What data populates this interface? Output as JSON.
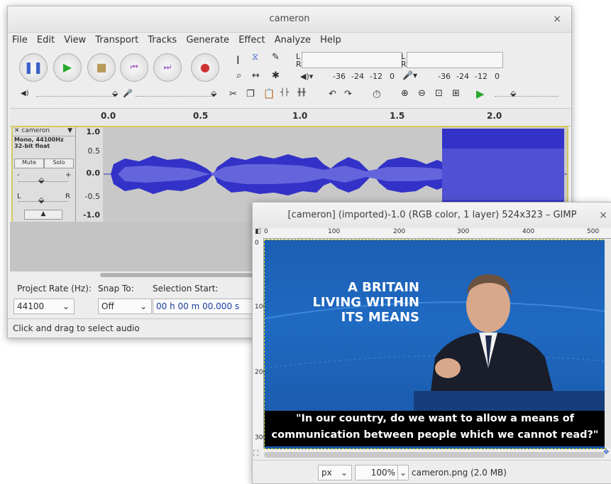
{
  "audacity": {
    "title": "cameron",
    "close": "×",
    "menu": [
      "File",
      "Edit",
      "View",
      "Transport",
      "Tracks",
      "Generate",
      "Effect",
      "Analyze",
      "Help"
    ],
    "meter": {
      "l": "L",
      "r": "R",
      "ticks": [
        "-36",
        "-24",
        "-12",
        "0"
      ]
    },
    "ruler": [
      "0.0",
      "0.5",
      "1.0",
      "1.5",
      "2.0"
    ],
    "track": {
      "name": "cameron",
      "format_line1": "Mono, 44100Hz",
      "format_line2": "32-bit float",
      "mute": "Mute",
      "solo": "Solo",
      "gain_minus": "-",
      "gain_plus": "+",
      "pan_l": "L",
      "pan_r": "R",
      "scale": [
        "1.0",
        "0.5",
        "0.0",
        "-0.5",
        "-1.0"
      ]
    },
    "selection": {
      "project_rate_label": "Project Rate (Hz):",
      "project_rate_value": "44100",
      "snap_label": "Snap To:",
      "snap_value": "Off",
      "sel_start_label": "Selection Start:",
      "sel_start_value": "00 h 00 m 00.000 s"
    },
    "status": "Click and drag to select audio",
    "colors": {
      "wave": "#3232c8",
      "wave_light": "#6464dc",
      "track_border": "#d8c95b"
    }
  },
  "gimp": {
    "title": "[cameron] (imported)-1.0 (RGB color, 1 layer) 524x323 – GIMP",
    "close": "×",
    "ruler": [
      "0",
      "100",
      "200",
      "300",
      "400",
      "500"
    ],
    "left_ruler": [
      "0",
      "100",
      "200",
      "300"
    ],
    "slogan": [
      "A BRITAIN",
      "LIVING WITHIN",
      "ITS MEANS"
    ],
    "caption_line1": "\"In our country, do we want to allow a means of",
    "caption_line2": "communication between people which we cannot read?\"",
    "unit": "px",
    "zoom": "100%",
    "file": "cameron.png (2.0 MB)"
  }
}
